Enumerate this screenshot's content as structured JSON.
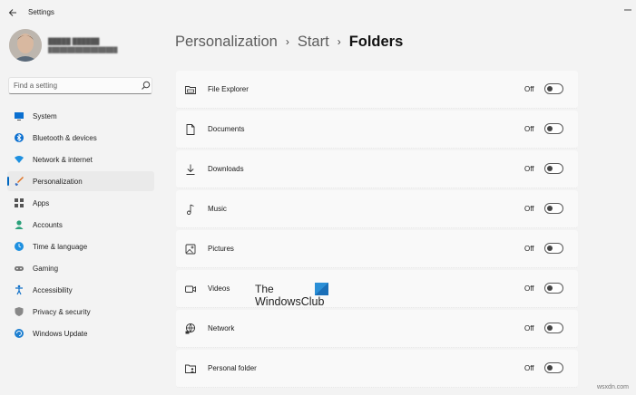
{
  "window": {
    "title": "Settings"
  },
  "search": {
    "placeholder": "Find a setting"
  },
  "breadcrumb": {
    "items": [
      "Personalization",
      "Start"
    ],
    "current": "Folders"
  },
  "nav": {
    "items": [
      {
        "label": "System",
        "icon": "monitor-icon",
        "selected": false
      },
      {
        "label": "Bluetooth & devices",
        "icon": "bluetooth-icon",
        "selected": false
      },
      {
        "label": "Network & internet",
        "icon": "wifi-icon",
        "selected": false
      },
      {
        "label": "Personalization",
        "icon": "brush-icon",
        "selected": true
      },
      {
        "label": "Apps",
        "icon": "apps-icon",
        "selected": false
      },
      {
        "label": "Accounts",
        "icon": "account-icon",
        "selected": false
      },
      {
        "label": "Time & language",
        "icon": "globe-clock-icon",
        "selected": false
      },
      {
        "label": "Gaming",
        "icon": "gamepad-icon",
        "selected": false
      },
      {
        "label": "Accessibility",
        "icon": "accessibility-icon",
        "selected": false
      },
      {
        "label": "Privacy & security",
        "icon": "shield-icon",
        "selected": false
      },
      {
        "label": "Windows Update",
        "icon": "update-icon",
        "selected": false
      }
    ]
  },
  "folders": [
    {
      "label": "File Explorer",
      "icon": "file-explorer-icon",
      "state": "Off"
    },
    {
      "label": "Documents",
      "icon": "document-icon",
      "state": "Off"
    },
    {
      "label": "Downloads",
      "icon": "download-icon",
      "state": "Off"
    },
    {
      "label": "Music",
      "icon": "music-icon",
      "state": "Off"
    },
    {
      "label": "Pictures",
      "icon": "picture-icon",
      "state": "Off"
    },
    {
      "label": "Videos",
      "icon": "video-icon",
      "state": "Off"
    },
    {
      "label": "Network",
      "icon": "network-icon",
      "state": "Off"
    },
    {
      "label": "Personal folder",
      "icon": "personal-folder-icon",
      "state": "Off"
    }
  ],
  "watermark": {
    "line1": "The",
    "line2": "WindowsClub"
  },
  "site": "wsxdn.com",
  "colors": {
    "accent": "#0067c0",
    "background": "#f3f3f3",
    "card": "#f9f9f9"
  }
}
